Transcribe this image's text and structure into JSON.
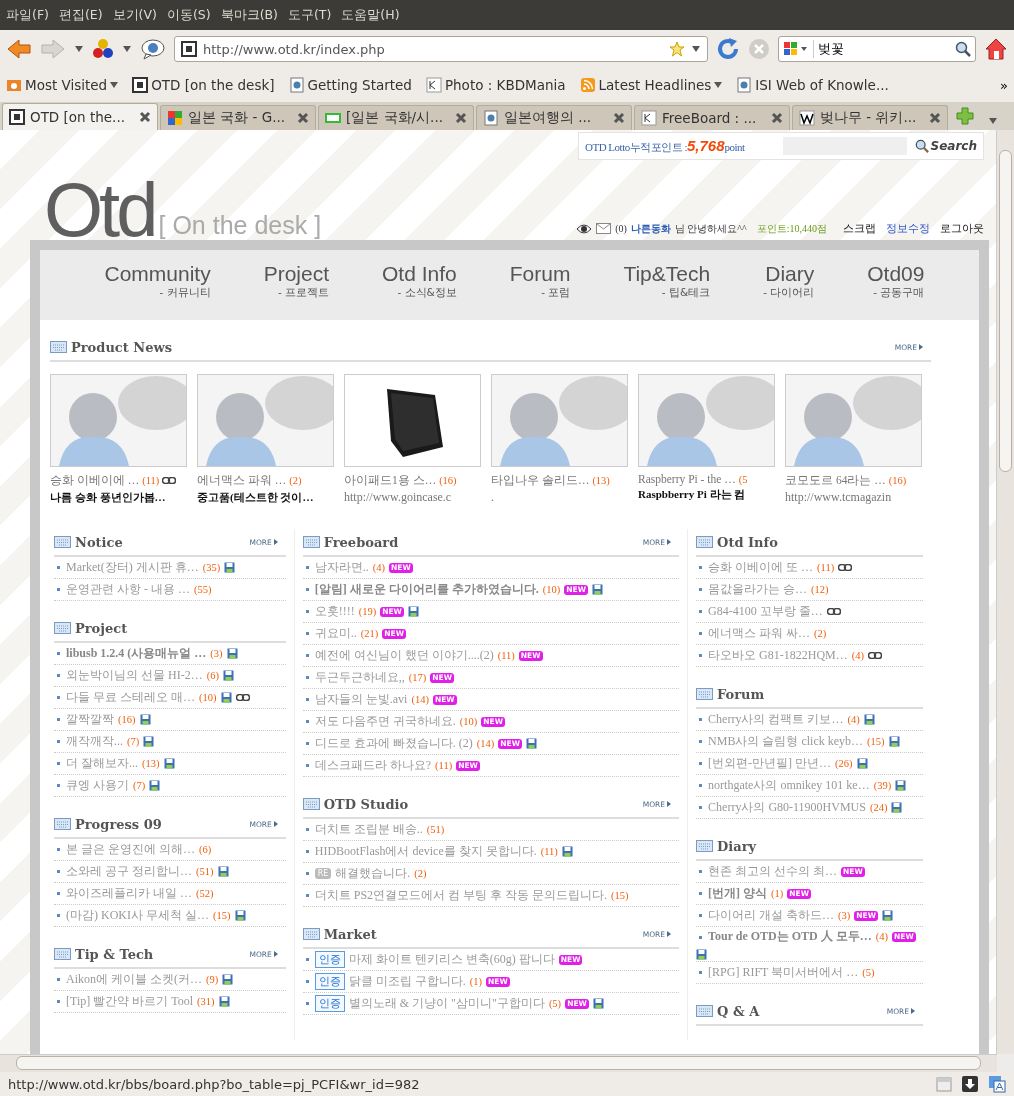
{
  "menu_bar": [
    "파일(F)",
    "편집(E)",
    "보기(V)",
    "이동(S)",
    "북마크(B)",
    "도구(T)",
    "도움말(H)"
  ],
  "toolbar": {
    "url": "http://www.otd.kr/index.php",
    "search_value": "벚꽃"
  },
  "bookmarks": [
    {
      "kind": "recent",
      "label": "Most Visited",
      "dropdown": true
    },
    {
      "kind": "site",
      "label": "OTD [on the desk]",
      "dropdown": false
    },
    {
      "kind": "page",
      "label": "Getting Started",
      "dropdown": false
    },
    {
      "kind": "kbd",
      "label": "Photo : KBDMania",
      "dropdown": false
    },
    {
      "kind": "feed",
      "label": "Latest Headlines",
      "dropdown": true
    },
    {
      "kind": "page",
      "label": "ISI Web of Knowle...",
      "dropdown": false
    }
  ],
  "bookmarks_overflow": "»",
  "tabs": [
    {
      "kind": "site",
      "label": "OTD [on the...",
      "selected": true
    },
    {
      "kind": "google",
      "label": "일본 국화 - G...",
      "selected": false
    },
    {
      "kind": "bar",
      "label": "[일본 국화/시...",
      "selected": false
    },
    {
      "kind": "page",
      "label": "일본여행의 ...",
      "selected": false
    },
    {
      "kind": "kbd",
      "label": "FreeBoard : ...",
      "selected": false
    },
    {
      "kind": "wiki",
      "label": "벚나무 - 위키...",
      "selected": false
    }
  ],
  "site": {
    "lotto": {
      "label": "OTD Lotto누적포인트 : ",
      "value": "5,768",
      "unit": "point",
      "search_button": "Search"
    },
    "logo": {
      "name": "Otd",
      "tagline": "[ On the desk ]"
    },
    "user_bar": {
      "mail_count": "(0)",
      "nickname": "나른동화",
      "greeting": "님 안녕하세요^^",
      "points": "포인트:10,440점",
      "links": [
        "스크랩",
        "정보수정",
        "로그아웃"
      ]
    },
    "nav": [
      {
        "title": "Community",
        "subtitle": "- 커뮤니티"
      },
      {
        "title": "Project",
        "subtitle": "- 프로젝트"
      },
      {
        "title": "Otd Info",
        "subtitle": "- 소식&정보"
      },
      {
        "title": "Forum",
        "subtitle": "- 포럼"
      },
      {
        "title": "Tip&Tech",
        "subtitle": "- 팁&테크"
      },
      {
        "title": "Diary",
        "subtitle": "- 다이어리"
      },
      {
        "title": "Otd09",
        "subtitle": "- 공동구매"
      }
    ],
    "product_news": {
      "title": "Product News",
      "more": "MORE",
      "items": [
        {
          "kind": "placeholder",
          "title": "승화 이베이에 …",
          "count": "(11)",
          "link": true,
          "subtitle": "나름 승화 풍년인가봅…",
          "subtitle_bold": true
        },
        {
          "kind": "placeholder",
          "title": "에너맥스 파워 …",
          "count": "(2)",
          "link": false,
          "subtitle": "중고품(테스트한 것이…",
          "subtitle_bold": true
        },
        {
          "kind": "tablet",
          "title": "아이패드1용 스…",
          "count": "(16)",
          "link": false,
          "subtitle": "http://www.goincase.c",
          "subtitle_bold": false
        },
        {
          "kind": "placeholder",
          "title": "타입나우 솔리드…",
          "count": "(13)",
          "link": false,
          "subtitle": ".",
          "subtitle_bold": false
        },
        {
          "kind": "placeholder",
          "title": "Raspberry Pi - the …",
          "count": "(5",
          "link": false,
          "subtitle": "Raspbberry Pi 라는 컴",
          "subtitle_bold": true
        },
        {
          "kind": "placeholder",
          "title": "코모도르 64라는 …",
          "count": "(16)",
          "link": false,
          "subtitle": "http://www.tcmagazin",
          "subtitle_bold": false
        }
      ]
    },
    "columns": [
      [
        {
          "title": "Notice",
          "more": "MORE",
          "items": [
            {
              "title": "Market(장터) 게시판 휴…",
              "count": "(35)",
              "bold": false,
              "marks": [
                {
                  "kind": "file"
                }
              ]
            },
            {
              "title": "운영관련 사항 - 내용 …",
              "count": "(55)",
              "bold": false
            }
          ]
        },
        {
          "title": "Project",
          "items": [
            {
              "title": "libusb 1.2.4 (사용매뉴얼 …",
              "count": "(3)",
              "bold": true,
              "marks": [
                {
                  "kind": "file"
                }
              ]
            },
            {
              "title": "외눈박이님의 선물 HI-2…",
              "count": "(6)",
              "bold": false,
              "marks": [
                {
                  "kind": "file"
                }
              ]
            },
            {
              "title": "다들 무료 스테레오 매…",
              "count": "(10)",
              "bold": false,
              "marks": [
                {
                  "kind": "file"
                },
                {
                  "kind": "link"
                }
              ]
            },
            {
              "title": "깔짝깔짝",
              "count": "(16)",
              "bold": false,
              "marks": [
                {
                  "kind": "file"
                }
              ]
            },
            {
              "title": "깨작깨작...",
              "count": "(7)",
              "bold": false,
              "marks": [
                {
                  "kind": "file"
                }
              ]
            },
            {
              "title": "더 잘해보자...",
              "count": "(13)",
              "bold": false,
              "marks": [
                {
                  "kind": "file"
                }
              ]
            },
            {
              "title": "큐엥 사용기",
              "count": "(7)",
              "bold": false,
              "marks": [
                {
                  "kind": "file"
                }
              ]
            }
          ]
        },
        {
          "title": "Progress 09",
          "more": "MORE",
          "items": [
            {
              "title": "본 글은 운영진에 의해…",
              "count": "(6)",
              "bold": false
            },
            {
              "title": "소와레 공구 정리합니…",
              "count": "(51)",
              "bold": false,
              "marks": [
                {
                  "kind": "file"
                }
              ]
            },
            {
              "title": "와이즈레플리카 내일 …",
              "count": "(52)",
              "bold": false
            },
            {
              "title": "(마감) KOKI사 무세척 실…",
              "count": "(15)",
              "bold": false,
              "marks": [
                {
                  "kind": "file"
                }
              ]
            }
          ]
        },
        {
          "title": "Tip & Tech",
          "more": "MORE",
          "items": [
            {
              "title": "Aikon에 케이블 소켓(커…",
              "count": "(9)",
              "bold": false,
              "marks": [
                {
                  "kind": "file"
                }
              ]
            },
            {
              "title": "[Tip] 빨간약 바르기 Tool",
              "count": "(31)",
              "bold": false,
              "marks": [
                {
                  "kind": "file"
                }
              ]
            }
          ]
        }
      ],
      [
        {
          "title": "Freeboard",
          "more": "MORE",
          "items": [
            {
              "title": "남자라면..",
              "count": "(4)",
              "bold": false,
              "marks": [
                {
                  "kind": "new",
                  "text": "NEW"
                }
              ]
            },
            {
              "title": "[알림] 새로운 다이어리를 추가하였습니다.",
              "count": "(10)",
              "bold": true,
              "marks": [
                {
                  "kind": "new",
                  "text": "NEW"
                },
                {
                  "kind": "file"
                }
              ]
            },
            {
              "title": "오홋!!!!",
              "count": "(19)",
              "bold": false,
              "marks": [
                {
                  "kind": "new",
                  "text": "NEW"
                },
                {
                  "kind": "file"
                }
              ]
            },
            {
              "title": "귀요미..",
              "count": "(21)",
              "bold": false,
              "marks": [
                {
                  "kind": "new",
                  "text": "NEW"
                }
              ]
            },
            {
              "title": "예전에 여신님이 했던 이야기....(2)",
              "count": "(11)",
              "bold": false,
              "marks": [
                {
                  "kind": "new",
                  "text": "NEW"
                }
              ]
            },
            {
              "title": "두근두근하네요,,",
              "count": "(17)",
              "bold": false,
              "marks": [
                {
                  "kind": "new",
                  "text": "NEW"
                }
              ]
            },
            {
              "title": "남자들의 눈빛.avi",
              "count": "(14)",
              "bold": false,
              "marks": [
                {
                  "kind": "new",
                  "text": "NEW"
                }
              ]
            },
            {
              "title": "저도 다음주면 귀국하네요.",
              "count": "(10)",
              "bold": false,
              "marks": [
                {
                  "kind": "new",
                  "text": "NEW"
                }
              ]
            },
            {
              "title": "디드로 효과에 빠졌습니다. (2)",
              "count": "(14)",
              "bold": false,
              "marks": [
                {
                  "kind": "new",
                  "text": "NEW"
                },
                {
                  "kind": "file"
                }
              ]
            },
            {
              "title": "데스크패드라 하나요?",
              "count": "(11)",
              "bold": false,
              "marks": [
                {
                  "kind": "new",
                  "text": "NEW"
                }
              ]
            }
          ]
        },
        {
          "title": "OTD Studio",
          "more": "MORE",
          "items": [
            {
              "title": "더치트 조립분 배송..",
              "count": "(51)",
              "bold": false
            },
            {
              "title": "HIDBootFlash에서 device를 찾지 못합니다.",
              "count": "(11)",
              "bold": false,
              "marks": [
                {
                  "kind": "file"
                }
              ]
            },
            {
              "prefix": {
                "kind": "reply",
                "text": "RE"
              },
              "title": "해결했습니다.",
              "count": "(2)",
              "bold": false
            },
            {
              "title": "더치트 PS2연결모드에서 컴 부팅 후 작동 문의드립니다.",
              "count": "(15)",
              "bold": false
            }
          ]
        },
        {
          "title": "Market",
          "more": "MORE",
          "items": [
            {
              "prefix": {
                "kind": "tag",
                "text": "인증"
              },
              "title": "마제 화이트 텐키리스 변축(60g) 팝니다",
              "bold": false,
              "marks": [
                {
                  "kind": "new",
                  "text": "NEW"
                }
              ]
            },
            {
              "prefix": {
                "kind": "tag",
                "text": "인증"
              },
              "title": "닭클 미조립 구합니다.",
              "count": "(1)",
              "bold": false,
              "marks": [
                {
                  "kind": "new",
                  "text": "NEW"
                }
              ]
            },
            {
              "prefix": {
                "kind": "tag",
                "text": "인증"
              },
              "title": "별의노래 & 기냥이 \"삼미니\"구합미다",
              "count": "(5)",
              "bold": false,
              "marks": [
                {
                  "kind": "new",
                  "text": "NEW"
                },
                {
                  "kind": "file"
                }
              ]
            }
          ]
        }
      ],
      [
        {
          "title": "Otd Info",
          "items": [
            {
              "title": "승화 이베이에 또 …",
              "count": "(11)",
              "bold": false,
              "marks": [
                {
                  "kind": "link"
                }
              ]
            },
            {
              "title": "몸값올라가는 승…",
              "count": "(12)",
              "bold": false
            },
            {
              "title": "G84-4100 꼬부랑 줄…",
              "bold": false,
              "marks": [
                {
                  "kind": "link"
                }
              ]
            },
            {
              "title": "에너맥스 파워 싸…",
              "count": "(2)",
              "bold": false
            },
            {
              "title": "타오바오 G81-1822HQM…",
              "count": "(4)",
              "bold": false,
              "marks": [
                {
                  "kind": "link"
                }
              ]
            }
          ]
        },
        {
          "title": "Forum",
          "items": [
            {
              "title": "Cherry사의 컴팩트 키보…",
              "count": "(4)",
              "bold": false,
              "marks": [
                {
                  "kind": "file"
                }
              ]
            },
            {
              "title": "NMB사의 슬림형 click keyb…",
              "count": "(15)",
              "bold": false,
              "marks": [
                {
                  "kind": "file"
                }
              ]
            },
            {
              "title": "[번외편-만년필] 만년…",
              "count": "(26)",
              "bold": false,
              "marks": [
                {
                  "kind": "file"
                }
              ]
            },
            {
              "title": "northgate사의 omnikey 101 ke…",
              "count": "(39)",
              "bold": false,
              "marks": [
                {
                  "kind": "file"
                }
              ]
            },
            {
              "title": "Cherry사의 G80-11900HVMUS",
              "count": "(24)",
              "bold": false,
              "marks": [
                {
                  "kind": "file"
                }
              ]
            }
          ]
        },
        {
          "title": "Diary",
          "items": [
            {
              "title": "현존 최고의 선수의 최…",
              "bold": false,
              "marks": [
                {
                  "kind": "new",
                  "text": "NEW"
                }
              ]
            },
            {
              "title": "[번개] 양식",
              "count": "(1)",
              "bold": true,
              "marks": [
                {
                  "kind": "new",
                  "text": "NEW"
                }
              ]
            },
            {
              "title": "다이어리 개설 축하드…",
              "count": "(3)",
              "bold": false,
              "marks": [
                {
                  "kind": "new",
                  "text": "NEW"
                },
                {
                  "kind": "file"
                }
              ]
            },
            {
              "title": "Tour de OTD는 OTD 人 모두…",
              "count": "(4)",
              "bold": true,
              "marks": [
                {
                  "kind": "new",
                  "text": "NEW"
                },
                {
                  "kind": "file"
                }
              ]
            },
            {
              "title": "[RPG] RIFT 북미서버에서 …",
              "count": "(5)",
              "bold": false
            }
          ]
        },
        {
          "title": "Q & A",
          "more": "MORE"
        }
      ]
    ]
  },
  "status_bar": {
    "text": "http://www.otd.kr/bbs/board.php?bo_table=pj_PCFI&wr_id=982"
  }
}
